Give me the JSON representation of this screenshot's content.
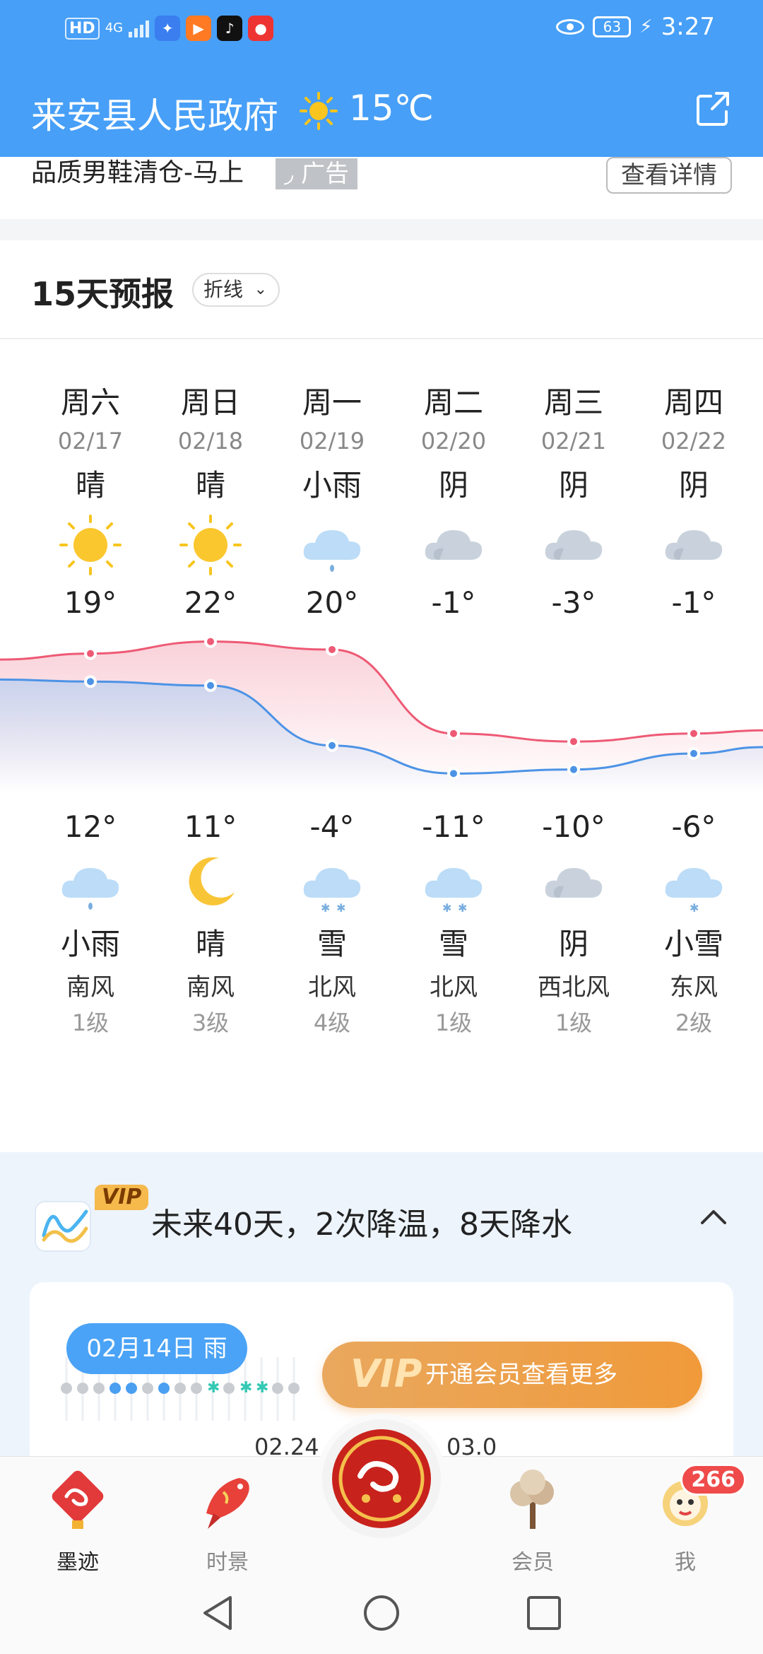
{
  "status": {
    "hd": "HD",
    "network": "4G",
    "eye_icon": "eye-icon",
    "battery": "63",
    "time": "3:27"
  },
  "header": {
    "title": "来安县人民政府",
    "temp": "15℃",
    "weather_icon": "sun-icon",
    "share_icon": "share-icon"
  },
  "ad": {
    "text": "品质男鞋清仓-马上",
    "tag": "广告",
    "button": "查看详情"
  },
  "forecast": {
    "title": "15天预报",
    "mode": "折线",
    "days": [
      {
        "dow": "周六",
        "date": "02/17",
        "day_cond": "晴",
        "day_icon": "sun",
        "high": "19°",
        "low": "12°",
        "night_icon": "rain-light",
        "night_cond": "小雨",
        "wind_dir": "南风",
        "wind_level": "1级"
      },
      {
        "dow": "周日",
        "date": "02/18",
        "day_cond": "晴",
        "day_icon": "sun",
        "high": "22°",
        "low": "11°",
        "night_icon": "moon",
        "night_cond": "晴",
        "wind_dir": "南风",
        "wind_level": "3级"
      },
      {
        "dow": "周一",
        "date": "02/19",
        "day_cond": "小雨",
        "day_icon": "rain-light",
        "high": "20°",
        "low": "-4°",
        "night_icon": "snow",
        "night_cond": "雪",
        "wind_dir": "北风",
        "wind_level": "4级"
      },
      {
        "dow": "周二",
        "date": "02/20",
        "day_cond": "阴",
        "day_icon": "cloud",
        "high": "-1°",
        "low": "-11°",
        "night_icon": "snow",
        "night_cond": "雪",
        "wind_dir": "北风",
        "wind_level": "1级"
      },
      {
        "dow": "周三",
        "date": "02/21",
        "day_cond": "阴",
        "day_icon": "cloud",
        "high": "-3°",
        "low": "-10°",
        "night_icon": "cloud",
        "night_cond": "阴",
        "wind_dir": "西北风",
        "wind_level": "1级"
      },
      {
        "dow": "周四",
        "date": "02/22",
        "day_cond": "阴",
        "day_icon": "cloud",
        "high": "-1°",
        "low": "-6°",
        "night_icon": "snow-light",
        "night_cond": "小雪",
        "wind_dir": "东风",
        "wind_level": "2级"
      }
    ]
  },
  "chart_data": {
    "type": "line",
    "categories": [
      "02/17",
      "02/18",
      "02/19",
      "02/20",
      "02/21",
      "02/22"
    ],
    "series": [
      {
        "values": [
          19,
          22,
          20,
          -1,
          -3,
          -1
        ],
        "color": "#ee5a75"
      },
      {
        "values": [
          12,
          11,
          -4,
          -11,
          -10,
          -6
        ],
        "color": "#4c93e6"
      }
    ],
    "ylim": [
      -12,
      23
    ]
  },
  "forty_day": {
    "badge": "VIP",
    "summary": "未来40天，2次降温，8天降水",
    "selected": "02月14日 雨",
    "cta": "开通会员查看更多",
    "cta_badge": "VIP",
    "x_labels": [
      "02.24",
      "03.0"
    ]
  },
  "nav": {
    "items": [
      {
        "label": "墨迹",
        "icon": "moji-icon"
      },
      {
        "label": "时景",
        "icon": "koi-icon"
      },
      {
        "label": "会员",
        "icon": "tree-icon"
      },
      {
        "label": "我",
        "icon": "lion-icon"
      }
    ],
    "badge": "266"
  },
  "colors": {
    "primary": "#479ff7",
    "high_line": "#ee5a75",
    "low_line": "#4c93e6",
    "vip": "#f09a3a"
  }
}
